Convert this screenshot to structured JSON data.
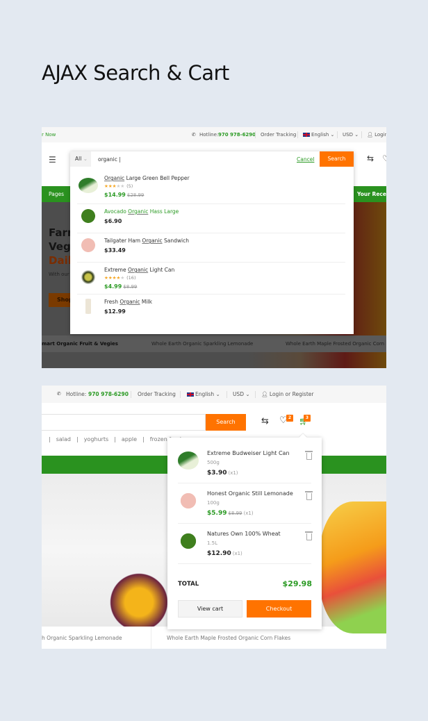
{
  "heading": "AJAX Search & Cart",
  "colors": {
    "accent_green": "#2a921f",
    "accent_orange": "#ff7300",
    "background": "#e3e9f1"
  },
  "search_demo": {
    "topbar": {
      "promo": "r Now",
      "hotline_label": "Hotline:",
      "hotline": "970 978-6290",
      "order_tracking": "Order Tracking",
      "language": "English",
      "currency": "USD",
      "login": "Login"
    },
    "category": "All",
    "query": "organic |",
    "cancel": "Cancel",
    "search_button": "Search",
    "nav": {
      "pages": "Pages",
      "recent": "Your Recent"
    },
    "hero": {
      "line1": "Farm",
      "line2": "Vege",
      "line3": "Dail",
      "sub": "With our",
      "cta": "Shop"
    },
    "strip": [
      "mart Organic Fruit & Vegies",
      "Whole Earth Organic Sparkling Lemonade",
      "Whole Earth Maple Frosted Organic Corn Fl"
    ],
    "results": [
      {
        "pre": "",
        "hl": "Organic",
        "post": " Large Green Bell Pepper",
        "rating": 3,
        "reviews": "(5)",
        "price": "$14.99",
        "old": "$28.99",
        "image": "leek"
      },
      {
        "pre": "Avocado ",
        "hl": "Organic",
        "post": " Hass Large",
        "price": "$6.90",
        "image": "broccoli"
      },
      {
        "pre": "Tailgater Ham ",
        "hl": "Organic",
        "post": " Sandwich",
        "price": "$33.49",
        "image": "chicken"
      },
      {
        "pre": "Extreme ",
        "hl": "Organic",
        "post": " Light Can",
        "rating": 4,
        "reviews": "(16)",
        "price": "$4.99",
        "old": "$8.99",
        "image": "avocado"
      },
      {
        "pre": "Fresh ",
        "hl": "Organic",
        "post": " Milk",
        "price": "$12.99",
        "image": "milk-bottle"
      }
    ]
  },
  "cart_demo": {
    "topbar": {
      "hotline_label": "Hotline:",
      "hotline": "970 978-6290",
      "order_tracking": "Order Tracking",
      "language": "English",
      "currency": "USD",
      "login": "Login or Register"
    },
    "search_button": "Search",
    "wishlist_count": "2",
    "cart_count": "3",
    "tags": [
      "|",
      "salad",
      "|",
      "yoghurts",
      "|",
      "apple",
      "|",
      "frozen food"
    ],
    "strip": [
      "h Organic Sparkling Lemonade",
      "Whole Earth Maple Frosted Organic Corn Flakes"
    ],
    "items": [
      {
        "name": "Extreme Budweiser Light Can",
        "size": "500g",
        "price": "$3.90",
        "qty": "(x1)",
        "image": "leek"
      },
      {
        "name": "Honest Organic Still Lemonade",
        "size": "100g",
        "price": "$5.99",
        "old": "$8.99",
        "qty": "(x1)",
        "image": "chicken"
      },
      {
        "name": "Natures Own 100% Wheat",
        "size": "1.5L",
        "price": "$12.90",
        "qty": "(x1)",
        "image": "broccoli"
      }
    ],
    "total_label": "TOTAL",
    "total": "$29.98",
    "view_cart": "View cart",
    "checkout": "Checkout"
  }
}
